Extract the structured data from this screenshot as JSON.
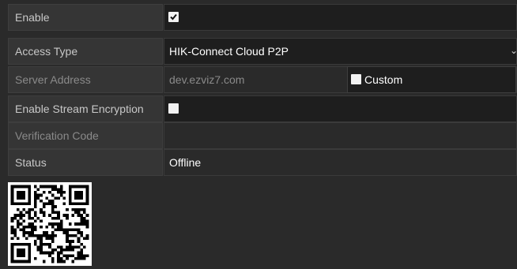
{
  "form": {
    "enable": {
      "label": "Enable",
      "checked": true
    },
    "access_type": {
      "label": "Access Type",
      "value": "HIK-Connect Cloud P2P"
    },
    "server_address": {
      "label": "Server Address",
      "value": "dev.ezviz7.com",
      "custom_label": "Custom",
      "custom_checked": false
    },
    "stream_encryption": {
      "label": "Enable Stream Encryption",
      "checked": false
    },
    "verification_code": {
      "label": "Verification Code",
      "value": ""
    },
    "status": {
      "label": "Status",
      "value": "Offline"
    }
  },
  "icons": {
    "dropdown": "chevron-down-icon",
    "qr": "qr-code-icon"
  }
}
